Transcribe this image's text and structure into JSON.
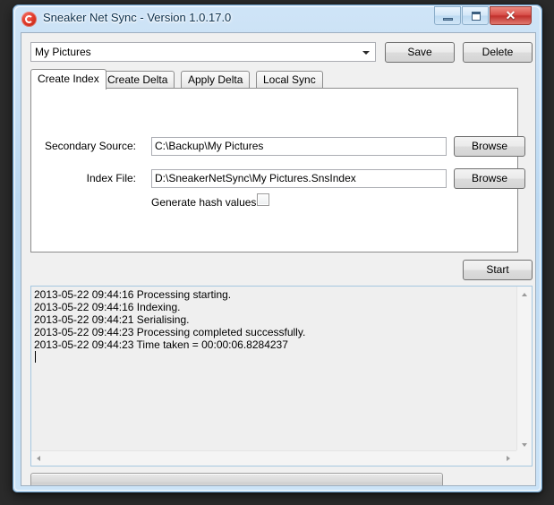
{
  "window": {
    "title": "Sneaker Net Sync - Version 1.0.17.0",
    "icon": "sync-refresh-icon",
    "controls": {
      "minimize": "minimize-icon",
      "maximize": "maximize-icon",
      "close": "✕"
    }
  },
  "toolbar": {
    "profile_combo_value": "My Pictures",
    "save_label": "Save",
    "delete_label": "Delete"
  },
  "tabs": [
    {
      "label": "Create Index",
      "active": true
    },
    {
      "label": "Create Delta",
      "active": false
    },
    {
      "label": "Apply Delta",
      "active": false
    },
    {
      "label": "Local Sync",
      "active": false
    }
  ],
  "create_index": {
    "secondary_source_label": "Secondary Source:",
    "secondary_source_value": "C:\\Backup\\My Pictures",
    "secondary_source_browse_label": "Browse",
    "index_file_label": "Index File:",
    "index_file_value": "D:\\SneakerNetSync\\My Pictures.SnsIndex",
    "index_file_browse_label": "Browse",
    "generate_hash_label": "Generate hash values:",
    "generate_hash_checked": false
  },
  "start_label": "Start",
  "log": {
    "lines": [
      "2013-05-22 09:44:16 Processing starting.",
      "2013-05-22 09:44:16 Indexing.",
      "2013-05-22 09:44:21 Serialising.",
      "2013-05-22 09:44:23 Processing completed successfully.",
      "2013-05-22 09:44:23 Time taken = 00:00:06.8284237"
    ],
    "text": "2013-05-22 09:44:16 Processing starting.\n2013-05-22 09:44:16 Indexing.\n2013-05-22 09:44:21 Serialising.\n2013-05-22 09:44:23 Processing completed successfully.\n2013-05-22 09:44:23 Time taken = 00:00:06.8284237"
  },
  "progress": {
    "value": 0
  },
  "colors": {
    "frame": "#bcd9f2",
    "client_bg": "#f0f0f0",
    "log_bg": "#efefef",
    "close_button": "#c1302c",
    "accent_border": "#a5c7e0"
  }
}
